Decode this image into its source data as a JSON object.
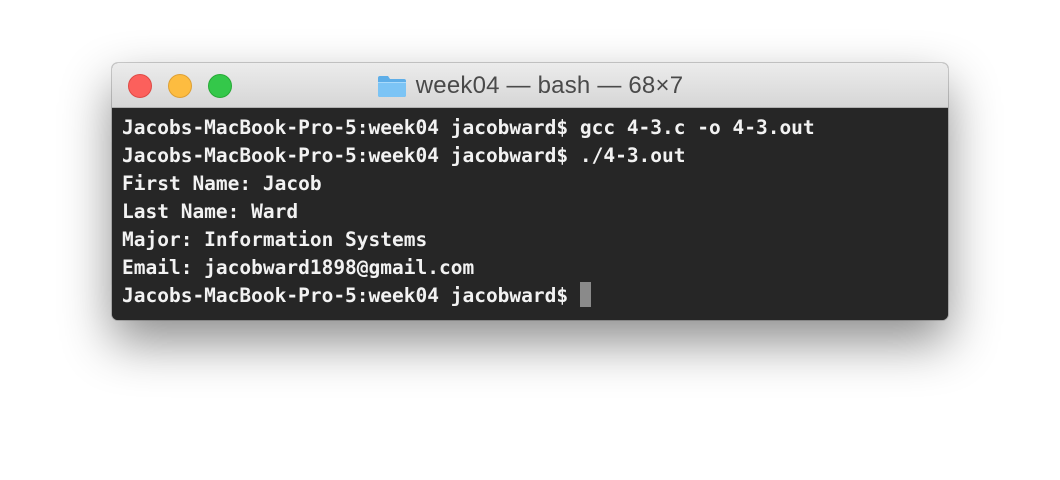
{
  "window": {
    "title": "week04 — bash — 68×7"
  },
  "traffic_lights": {
    "close_color": "#fc605c",
    "minimize_color": "#fdbc40",
    "zoom_color": "#34c84a"
  },
  "icons": {
    "title": "folder-icon"
  },
  "terminal": {
    "lines": [
      "Jacobs-MacBook-Pro-5:week04 jacobward$ gcc 4-3.c -o 4-3.out",
      "Jacobs-MacBook-Pro-5:week04 jacobward$ ./4-3.out",
      "First Name: Jacob",
      "Last Name: Ward",
      "Major: Information Systems",
      "Email: jacobward1898@gmail.com"
    ],
    "prompt": "Jacobs-MacBook-Pro-5:week04 jacobward$"
  }
}
